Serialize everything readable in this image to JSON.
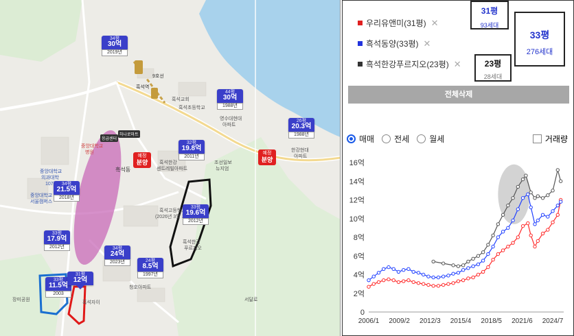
{
  "map": {
    "markers": [
      {
        "area": "34평",
        "price": "30억",
        "year": "2019년"
      },
      {
        "area": "44평",
        "price": "30억",
        "year": "1988년"
      },
      {
        "area": "26평",
        "price": "20.3억",
        "year": "1988년"
      },
      {
        "area": "32평",
        "price": "19.8억",
        "year": "2011년"
      },
      {
        "area": "33평",
        "price": "19.6억",
        "year": "2012년"
      },
      {
        "area": "34평",
        "price": "21.5억",
        "year": "2018년"
      },
      {
        "area": "33평",
        "price": "17.9억",
        "year": "2012년"
      },
      {
        "area": "34평",
        "price": "24억",
        "year": "2023년"
      },
      {
        "area": "24평",
        "price": "8.5억",
        "year": "1997년"
      },
      {
        "area": "33평",
        "price": "11.5억",
        "year": "2003"
      },
      {
        "area": "31평",
        "price": "12억",
        "year": ""
      }
    ],
    "sale_tags": [
      {
        "top": "예정",
        "main": "분양"
      },
      {
        "top": "예정",
        "main": "분양"
      }
    ],
    "labels": {
      "heukseok_station": "흑석역",
      "station_exit": "9호선",
      "church": "흑석교회",
      "heukseok_elem": "흑석초등학교",
      "yeongsu": "영수대현대",
      "yeongsu2": "아파트",
      "hangang": "한강현대",
      "hangang2": "아파트",
      "chungang_hosp": "중앙대학교",
      "chungang_hosp2": "병원",
      "center": "흑석한강",
      "center2": "센트레빌아파트",
      "joseon": "조선일보",
      "joseon2": "뉴지엄",
      "heukseok_dong": "흑석동",
      "heukseok_high": "흑석고등학교",
      "heukseok_high2": "(2026년 3월 개교)",
      "heukseok_fru": "흑석한강",
      "heukseok_fru2": "푸르지오",
      "cheongho": "청호아파트",
      "myungsu": "명수대",
      "chungang_univ": "중앙대학교",
      "chungang_univ2": "서울캠퍼스",
      "jungang_med": "중앙대학교",
      "jungang_med2": "의과대학",
      "jungang_med3": "107관",
      "seoulnat": "서달산",
      "river_park": "흑석체육공원",
      "park1": "장미공원",
      "hangang_txt": "한강",
      "yeonjae": "한강유수지",
      "heukseok_seong": "흑석자이",
      "wooriyu": "우리유앤미",
      "sangdo": "상도동",
      "park_rd": "현충로",
      "ambul": "응급센터",
      "pharm": "약국",
      "daehak": "대학가",
      "arirang": "아리랑",
      "hyunsuk": "흑석리버파크",
      "fru_text": "흑석한강푸르지오",
      "hanshin": "흑석한신",
      "myeong": "명수대현대아파트",
      "seodal": "서달로"
    },
    "small_tags": [
      "응급센터",
      "하나로마트"
    ]
  },
  "panel": {
    "legend": [
      {
        "label": "우리유앤미(31평)",
        "color": "#e02020"
      },
      {
        "label": "흑석동양(33평)",
        "color": "#2233dd"
      },
      {
        "label": "흑석한강푸르지오(23평)",
        "color": "#333333"
      }
    ],
    "callouts": [
      {
        "title": "31평",
        "sub": "93세대"
      },
      {
        "title": "33평",
        "sub": "276세대"
      },
      {
        "title": "23평",
        "sub": "28세대"
      }
    ],
    "delete_all": "전체삭제",
    "radios": [
      {
        "label": "매매",
        "selected": true
      },
      {
        "label": "전세",
        "selected": false
      },
      {
        "label": "월세",
        "selected": false
      }
    ],
    "volume_label": "거래량"
  },
  "chart_data": {
    "type": "line",
    "y_ticks": [
      "0",
      "2억",
      "4억",
      "6억",
      "8억",
      "10억",
      "12억",
      "14억",
      "16억"
    ],
    "x_ticks": [
      "2006/1",
      "2009/2",
      "2012/3",
      "2015/4",
      "2018/5",
      "2021/6",
      "2024/7"
    ],
    "ylim": [
      0,
      16
    ],
    "xlim": [
      2006.0,
      2025.6
    ],
    "series": [
      {
        "name": "우리유앤미(31평)",
        "color": "#ff2a2a",
        "points": [
          [
            2006.0,
            2.7
          ],
          [
            2006.5,
            3.0
          ],
          [
            2007.0,
            3.2
          ],
          [
            2007.5,
            3.4
          ],
          [
            2008.0,
            3.5
          ],
          [
            2008.5,
            3.4
          ],
          [
            2009.0,
            3.2
          ],
          [
            2009.5,
            3.3
          ],
          [
            2010.0,
            3.4
          ],
          [
            2010.5,
            3.2
          ],
          [
            2011.0,
            3.1
          ],
          [
            2011.5,
            3.0
          ],
          [
            2012.0,
            2.9
          ],
          [
            2012.5,
            2.8
          ],
          [
            2013.0,
            2.8
          ],
          [
            2013.5,
            2.9
          ],
          [
            2014.0,
            3.0
          ],
          [
            2014.5,
            3.1
          ],
          [
            2015.0,
            3.3
          ],
          [
            2015.5,
            3.4
          ],
          [
            2016.0,
            3.6
          ],
          [
            2016.5,
            3.7
          ],
          [
            2017.0,
            4.0
          ],
          [
            2017.5,
            4.3
          ],
          [
            2018.0,
            4.8
          ],
          [
            2018.5,
            5.6
          ],
          [
            2019.0,
            6.2
          ],
          [
            2019.5,
            6.6
          ],
          [
            2020.0,
            7.0
          ],
          [
            2020.5,
            7.4
          ],
          [
            2021.0,
            8.0
          ],
          [
            2021.5,
            9.2
          ],
          [
            2022.0,
            9.5
          ],
          [
            2022.3,
            8.2
          ],
          [
            2022.7,
            7.0
          ],
          [
            2023.0,
            7.6
          ],
          [
            2023.5,
            8.4
          ],
          [
            2024.0,
            8.8
          ],
          [
            2024.5,
            9.6
          ],
          [
            2025.0,
            10.4
          ],
          [
            2025.3,
            12.0
          ]
        ]
      },
      {
        "name": "흑석동양(33평)",
        "color": "#2040ff",
        "points": [
          [
            2006.0,
            3.4
          ],
          [
            2006.5,
            3.8
          ],
          [
            2007.0,
            4.2
          ],
          [
            2007.5,
            4.6
          ],
          [
            2008.0,
            4.8
          ],
          [
            2008.5,
            4.6
          ],
          [
            2009.0,
            4.3
          ],
          [
            2009.5,
            4.5
          ],
          [
            2010.0,
            4.6
          ],
          [
            2010.5,
            4.3
          ],
          [
            2011.0,
            4.2
          ],
          [
            2011.5,
            4.0
          ],
          [
            2012.0,
            3.8
          ],
          [
            2012.5,
            3.7
          ],
          [
            2013.0,
            3.7
          ],
          [
            2013.5,
            3.8
          ],
          [
            2014.0,
            3.9
          ],
          [
            2014.5,
            4.1
          ],
          [
            2015.0,
            4.2
          ],
          [
            2015.5,
            4.5
          ],
          [
            2016.0,
            4.7
          ],
          [
            2016.5,
            4.9
          ],
          [
            2017.0,
            5.1
          ],
          [
            2017.5,
            5.5
          ],
          [
            2018.0,
            6.2
          ],
          [
            2018.5,
            7.0
          ],
          [
            2019.0,
            8.0
          ],
          [
            2019.5,
            8.6
          ],
          [
            2020.0,
            9.0
          ],
          [
            2020.5,
            9.8
          ],
          [
            2021.0,
            11.0
          ],
          [
            2021.5,
            12.2
          ],
          [
            2022.0,
            12.6
          ],
          [
            2022.3,
            11.2
          ],
          [
            2022.7,
            9.4
          ],
          [
            2023.0,
            9.8
          ],
          [
            2023.5,
            10.4
          ],
          [
            2024.0,
            10.2
          ],
          [
            2024.5,
            10.8
          ],
          [
            2025.0,
            11.4
          ],
          [
            2025.3,
            11.8
          ]
        ]
      },
      {
        "name": "흑석한강푸르지오(23평)",
        "color": "#555555",
        "points": [
          [
            2012.5,
            5.4
          ],
          [
            2013.5,
            5.2
          ],
          [
            2014.5,
            5.0
          ],
          [
            2015.0,
            4.9
          ],
          [
            2015.5,
            5.0
          ],
          [
            2016.0,
            5.4
          ],
          [
            2016.5,
            5.7
          ],
          [
            2017.0,
            6.0
          ],
          [
            2017.5,
            6.4
          ],
          [
            2018.0,
            7.2
          ],
          [
            2018.5,
            8.2
          ],
          [
            2019.0,
            9.4
          ],
          [
            2019.5,
            10.4
          ],
          [
            2020.0,
            11.4
          ],
          [
            2020.5,
            12.2
          ],
          [
            2021.0,
            13.4
          ],
          [
            2021.5,
            14.2
          ],
          [
            2021.8,
            14.6
          ],
          [
            2022.3,
            12.8
          ],
          [
            2022.7,
            12.2
          ],
          [
            2023.0,
            12.4
          ],
          [
            2023.5,
            12.2
          ],
          [
            2024.0,
            12.5
          ],
          [
            2024.5,
            13.0
          ],
          [
            2025.0,
            15.2
          ],
          [
            2025.3,
            14.0
          ]
        ]
      }
    ],
    "highlight": {
      "cx": 2020.6,
      "cy": 12.6,
      "rx": 1.6,
      "ry": 3.2
    }
  }
}
